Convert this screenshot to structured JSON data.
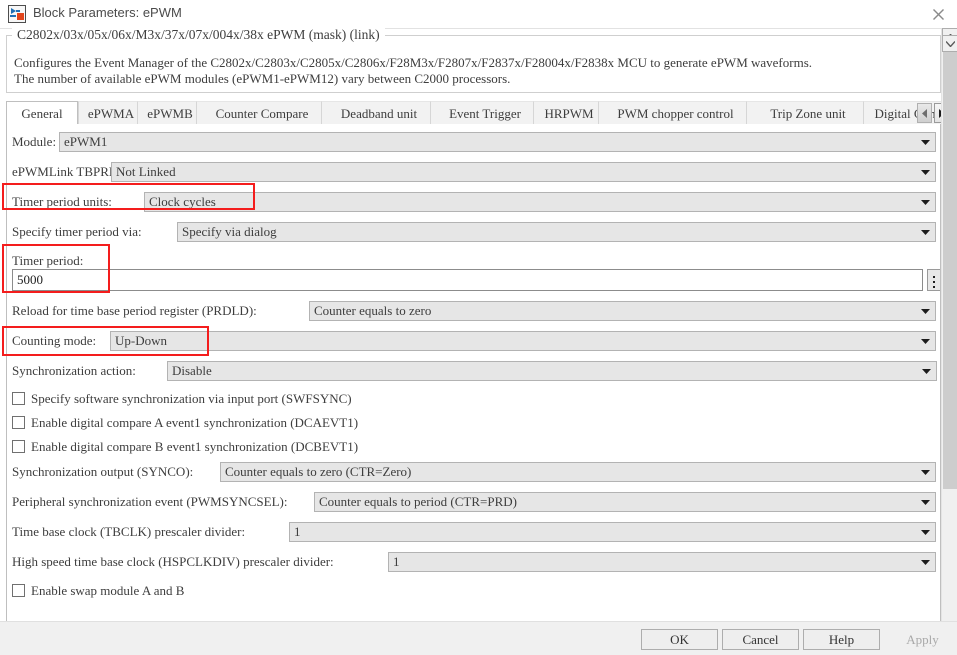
{
  "window": {
    "title": "Block Parameters: ePWM",
    "icon": "simulink-block-icon",
    "close_icon": "close-icon"
  },
  "group": {
    "legend": "C2802x/03x/05x/06x/M3x/37x/07x/004x/38x ePWM (mask) (link)",
    "description_line1": "Configures the Event Manager of the C2802x/C2803x/C2805x/C2806x/F28M3x/F2807x/F2837x/F28004x/F2838x MCU to generate ePWM waveforms.",
    "description_line2": "The number of available ePWM modules (ePWM1-ePWM12) vary between C2000 processors."
  },
  "tabs": {
    "items": [
      {
        "label": "General",
        "active": true
      },
      {
        "label": "ePWMA",
        "active": false
      },
      {
        "label": "ePWMB",
        "active": false
      },
      {
        "label": "Counter Compare",
        "active": false
      },
      {
        "label": "Deadband unit",
        "active": false
      },
      {
        "label": "Event Trigger",
        "active": false
      },
      {
        "label": "HRPWM",
        "active": false
      },
      {
        "label": "PWM chopper control",
        "active": false
      },
      {
        "label": "Trip Zone unit",
        "active": false
      },
      {
        "label": "Digital Compare",
        "active": false
      }
    ],
    "scroll_left_icon": "chevron-left-icon",
    "scroll_right_icon": "chevron-right-icon"
  },
  "form": {
    "module": {
      "label": "Module:",
      "value": "ePWM1"
    },
    "epwmlink_tbprd": {
      "label": "ePWMLink TBPRD",
      "value": "Not Linked"
    },
    "timer_period_units": {
      "label": "Timer period units:",
      "value": "Clock cycles",
      "highlighted": true
    },
    "specify_timer_period_via": {
      "label": "Specify timer period via:",
      "value": "Specify via dialog"
    },
    "timer_period": {
      "label": "Timer period:",
      "value": "5000",
      "highlighted": true,
      "spinner_icon": "vertical-dots-icon"
    },
    "prdld": {
      "label": "Reload for time base period register (PRDLD):",
      "value": "Counter equals to zero"
    },
    "counting_mode": {
      "label": "Counting mode:",
      "value": "Up-Down",
      "highlighted": true
    },
    "sync_action": {
      "label": "Synchronization action:",
      "value": "Disable"
    },
    "cb_swfsync": {
      "label": "Specify software synchronization via input port (SWFSYNC)",
      "checked": false
    },
    "cb_dcaevt1": {
      "label": "Enable digital compare A event1 synchronization (DCAEVT1)",
      "checked": false
    },
    "cb_dcbevt1": {
      "label": "Enable digital compare B event1 synchronization (DCBEVT1)",
      "checked": false
    },
    "synco": {
      "label": "Synchronization output (SYNCO):",
      "value": "Counter equals to zero (CTR=Zero)"
    },
    "pwmsyncsel": {
      "label": "Peripheral synchronization event (PWMSYNCSEL):",
      "value": "Counter equals to period (CTR=PRD)"
    },
    "tbclk": {
      "label": "Time base clock (TBCLK) prescaler divider:",
      "value": "1"
    },
    "hspclkdiv": {
      "label": "High speed time base clock (HSPCLKDIV) prescaler divider:",
      "value": "1"
    },
    "cb_swap": {
      "label": "Enable swap module A and B",
      "checked": false
    }
  },
  "footer": {
    "ok": "OK",
    "cancel": "Cancel",
    "help": "Help",
    "apply": "Apply",
    "apply_enabled": false
  },
  "colors": {
    "highlight": "#f41d1d",
    "combo_bg": "#e6e6e6",
    "panel_bg": "#ffffff"
  },
  "scrollbar": {
    "up_icon": "chevron-up-icon",
    "down_icon": "chevron-down-icon"
  }
}
